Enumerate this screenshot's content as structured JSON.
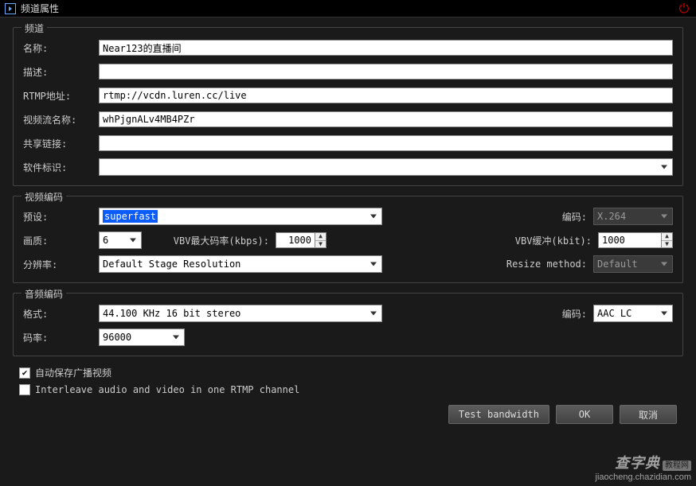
{
  "title": "频道属性",
  "channel": {
    "legend": "频道",
    "labels": {
      "name": "名称:",
      "desc": "描述:",
      "rtmp": "RTMP地址:",
      "stream": "视频流名称:",
      "share": "共享链接:",
      "software": "软件标识:"
    },
    "values": {
      "name": "Near123的直播间",
      "desc": "",
      "rtmp": "rtmp://vcdn.luren.cc/live",
      "stream": "whPjgnALv4MB4PZr",
      "share": "",
      "software": ""
    }
  },
  "video": {
    "legend": "视频编码",
    "labels": {
      "preset": "预设:",
      "quality": "画质:",
      "vbv_max": "VBV最大码率(kbps):",
      "resolution": "分辨率:",
      "codec": "编码:",
      "vbv_buffer": "VBV缓冲(kbit):",
      "resize": "Resize method:"
    },
    "values": {
      "preset": "superfast",
      "quality": "6",
      "vbv_max": "1000",
      "resolution": "Default Stage Resolution",
      "codec": "X.264",
      "vbv_buffer": "1000",
      "resize": "Default"
    }
  },
  "audio": {
    "legend": "音频编码",
    "labels": {
      "format": "格式:",
      "bitrate": "码率:",
      "codec": "编码:"
    },
    "values": {
      "format": "44.100 KHz 16 bit stereo",
      "bitrate": "96000",
      "codec": "AAC LC"
    }
  },
  "options": {
    "autosave": "自动保存广播视频",
    "interleave": "Interleave audio and video in one RTMP channel"
  },
  "buttons": {
    "test": "Test bandwidth",
    "ok": "OK",
    "cancel": "取消"
  },
  "watermark": {
    "line1": "查字典",
    "line2": "jiaocheng.chazidian.com",
    "badge": "教程网"
  }
}
